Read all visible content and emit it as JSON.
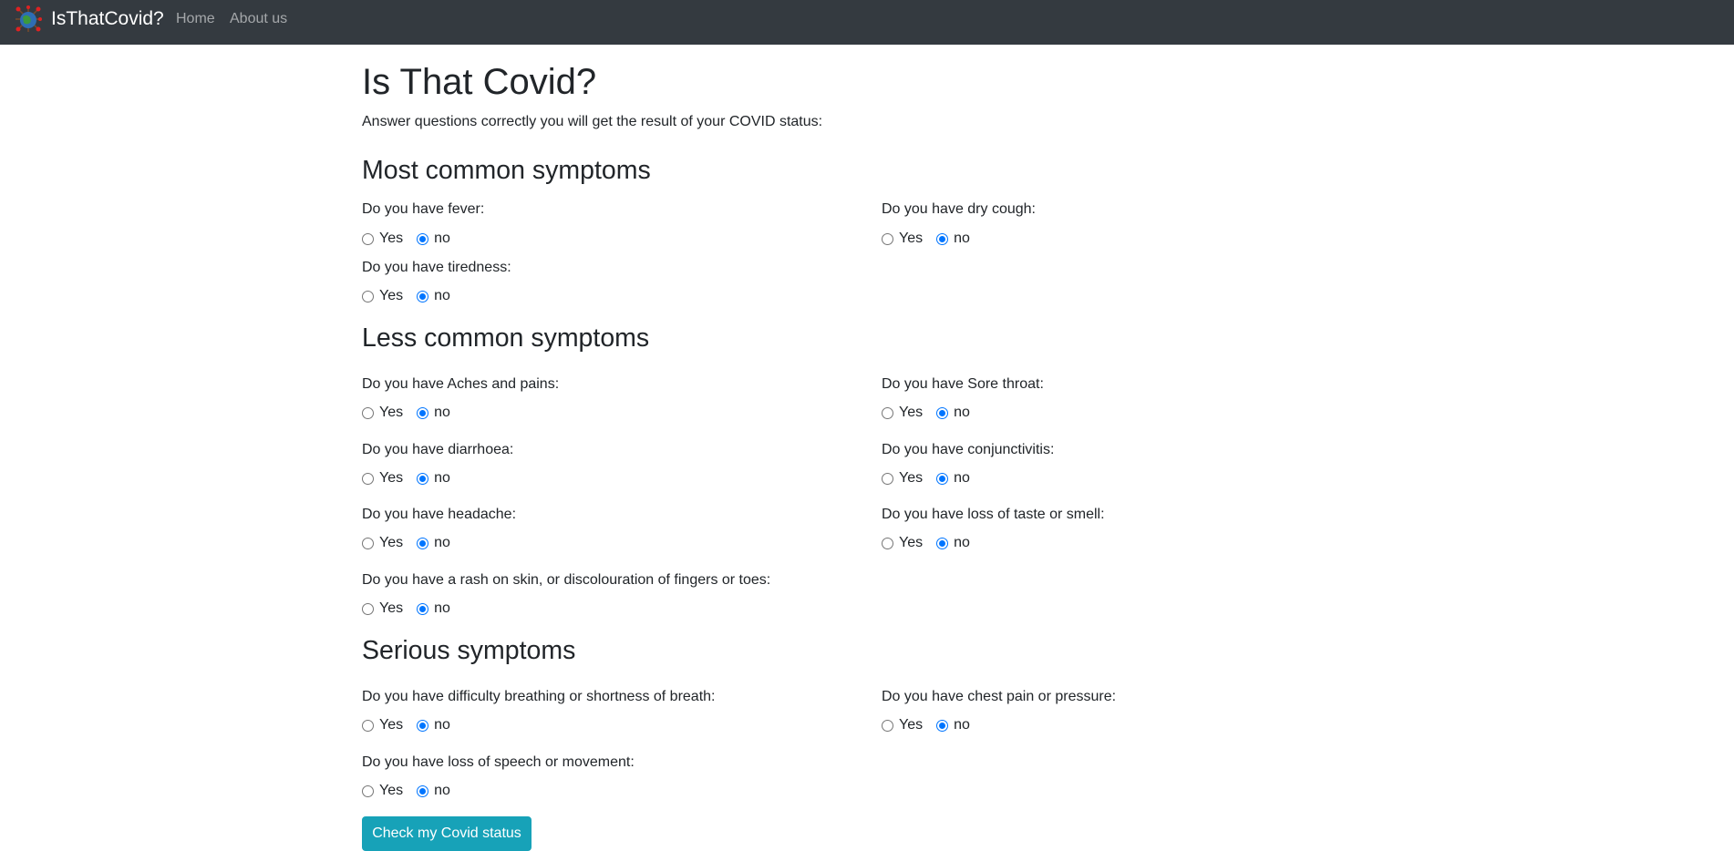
{
  "navbar": {
    "brand": "IsThatCovid?",
    "links": [
      "Home",
      "About us"
    ]
  },
  "page": {
    "title": "Is That Covid?",
    "intro": "Answer questions correctly you will get the result of your COVID status:"
  },
  "sections": [
    {
      "title": "Most common symptoms"
    },
    {
      "title": "Less common symptoms"
    },
    {
      "title": "Serious symptoms"
    }
  ],
  "options": {
    "yes": "Yes",
    "no": "no"
  },
  "questions": {
    "fever": {
      "label": "Do you have fever:",
      "selected": "no"
    },
    "dry_cough": {
      "label": "Do you have dry cough:",
      "selected": "no"
    },
    "tiredness": {
      "label": "Do you have tiredness:",
      "selected": "no"
    },
    "aches": {
      "label": "Do you have Aches and pains:",
      "selected": "no"
    },
    "sore_throat": {
      "label": "Do you have Sore throat:",
      "selected": "no"
    },
    "diarrhoea": {
      "label": "Do you have diarrhoea:",
      "selected": "no"
    },
    "conjunctivitis": {
      "label": "Do you have conjunctivitis:",
      "selected": "no"
    },
    "headache": {
      "label": "Do you have headache:",
      "selected": "no"
    },
    "taste_smell": {
      "label": "Do you have loss of taste or smell:",
      "selected": "no"
    },
    "rash": {
      "label": "Do you have a rash on skin, or discolouration of fingers or toes:",
      "selected": "no"
    },
    "breathing": {
      "label": "Do you have difficulty breathing or shortness of breath:",
      "selected": "no"
    },
    "chest_pain": {
      "label": "Do you have chest pain or pressure:",
      "selected": "no"
    },
    "speech": {
      "label": "Do you have loss of speech or movement:",
      "selected": "no"
    }
  },
  "submit": {
    "label": "Check my Covid status"
  },
  "colors": {
    "navbar": "#343a40",
    "button": "#17a2b8",
    "radio_checked": "#0075ff"
  }
}
